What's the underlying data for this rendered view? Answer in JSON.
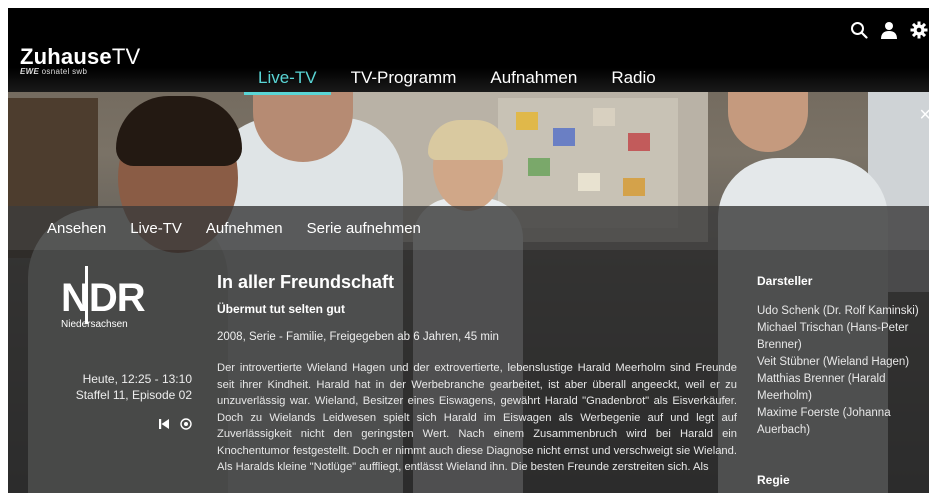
{
  "app": {
    "logo_main": "Zuhause",
    "logo_tv": "TV",
    "logo_sub_brand": "EWE",
    "logo_sub_rest": "osnatel  swb"
  },
  "nav": {
    "items": [
      {
        "label": "Live-TV",
        "active": true
      },
      {
        "label": "TV-Programm",
        "active": false
      },
      {
        "label": "Aufnahmen",
        "active": false
      },
      {
        "label": "Radio",
        "active": false
      }
    ]
  },
  "header_icons": [
    "search-icon",
    "user-icon",
    "gear-icon"
  ],
  "close_label": "×",
  "actions": [
    "Ansehen",
    "Live-TV",
    "Aufnehmen",
    "Serie aufnehmen"
  ],
  "channel": {
    "logo_text": "NDR",
    "region": "Niedersachsen"
  },
  "schedule": {
    "time": "Heute, 12:25 - 13:10",
    "episode": "Staffel 11, Episode 02"
  },
  "program": {
    "title": "In aller Freundschaft",
    "subtitle": "Übermut tut selten gut",
    "meta": "2008, Serie - Familie, Freigegeben ab 6 Jahren, 45 min",
    "description": "Der introvertierte Wieland Hagen und der extrovertierte, lebenslustige Harald Meerholm sind Freunde seit ihrer Kindheit. Harald hat in der Werbebranche gearbeitet, ist aber überall angeeckt, weil er zu unzuverlässig war. Wieland, Besitzer eines Eiswagens, gewährt Harald \"Gnadenbrot\" als Eisverkäufer. Doch zu Wielands Leidwesen spielt sich Harald im Eiswagen als Werbegenie auf und legt auf Zuverlässigkeit nicht den geringsten Wert. Nach einem Zusammenbruch wird bei Harald ein Knochentumor festgestellt. Doch er nimmt auch diese Diagnose nicht ernst und verschweigt sie Wieland. Als Haralds kleine \"Notlüge\" auffliegt, entlässt Wieland ihn. Die besten Freunde zerstreiten sich. Als"
  },
  "cast": {
    "heading": "Darsteller",
    "members": [
      "Udo Schenk (Dr. Rolf Kaminski)",
      "Michael Trischan (Hans-Peter Brenner)",
      "Veit Stübner (Wieland Hagen)",
      "Matthias Brenner (Harald Meerholm)",
      "Maxime Foerste (Johanna Auerbach)"
    ],
    "regie_heading": "Regie"
  },
  "colors": {
    "accent": "#5ad6d6",
    "panel": "#3c3c3c"
  }
}
